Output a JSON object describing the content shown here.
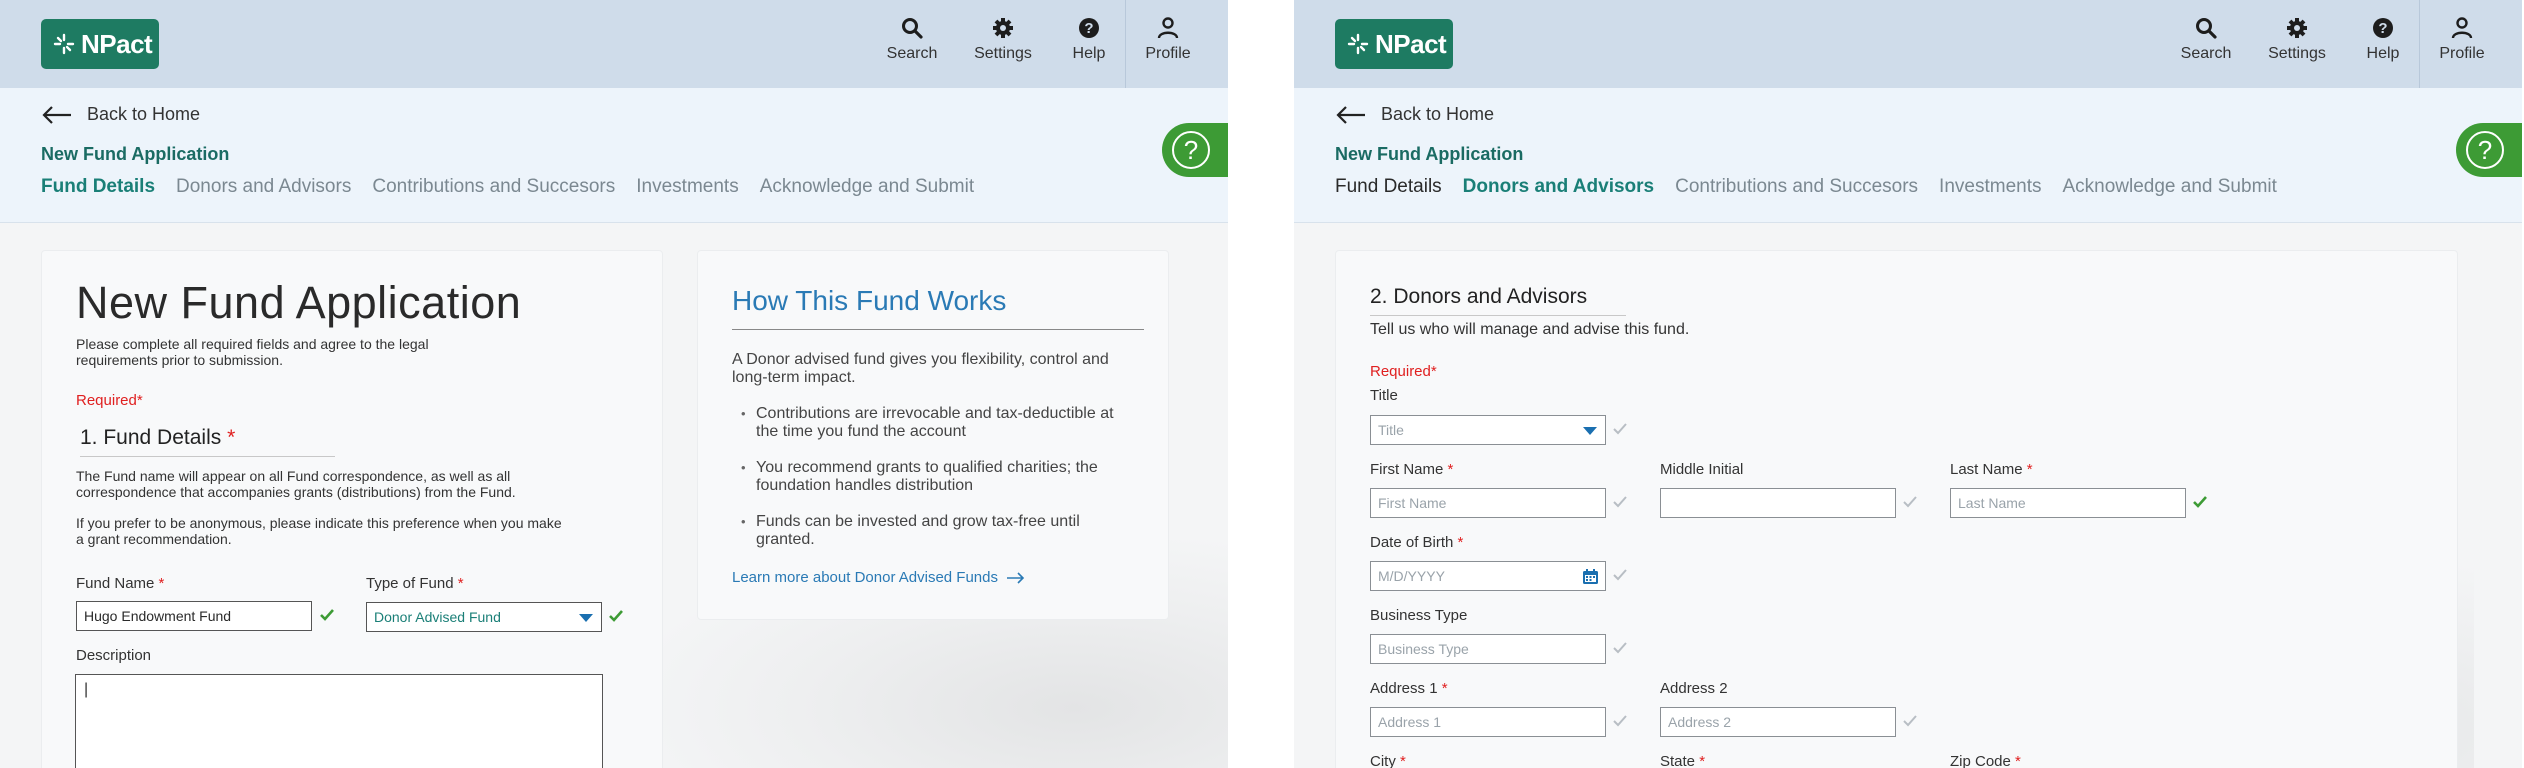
{
  "app": {
    "logo_text": "NPact"
  },
  "topnav": {
    "search": "Search",
    "settings": "Settings",
    "help": "Help",
    "profile": "Profile"
  },
  "subheader": {
    "back": "Back to Home",
    "title": "New Fund Application",
    "tabs": [
      "Fund Details",
      "Donors and Advisors",
      "Contributions and Succesors",
      "Investments",
      "Acknowledge and Submit"
    ],
    "help_icon": "?"
  },
  "left": {
    "heading": "New Fund Application",
    "intro": "Please complete all required fields and agree to the legal requirements prior to submission.",
    "required": "Required*",
    "section": "1. Fund Details",
    "section_star": "*",
    "para1": "The Fund name will appear on all Fund correspondence, as well as all correspondence that accompanies grants (distributions) from the Fund.",
    "para2": "If you prefer to be anonymous, please indicate this preference when you make a grant recommendation.",
    "fund_name_label": "Fund Name",
    "fund_name_value": "Hugo Endowment Fund",
    "type_label": "Type of Fund",
    "type_value": "Donor Advised Fund",
    "star": "*",
    "description_label": "Description",
    "description_value": "|"
  },
  "info": {
    "title": "How This Fund Works",
    "text": "A Donor advised fund gives you flexibility, control and long-term impact.",
    "bullets": [
      "Contributions are irrevocable and tax-deductible at the time you fund the account",
      "You recommend grants to qualified charities; the foundation handles distribution",
      "Funds can be invested and grow tax-free until granted."
    ],
    "link": "Learn more about Donor Advised Funds"
  },
  "right": {
    "section": "2. Donors and Advisors",
    "subtitle": "Tell us who will manage and advise this fund.",
    "required": "Required*",
    "title_label": "Title",
    "title_ph": "Title",
    "first_label": "First Name",
    "first_ph": "First Name",
    "middle_label": "Middle Initial",
    "last_label": "Last Name",
    "last_ph": "Last Name",
    "dob_label": "Date of Birth",
    "dob_ph": "M/D/YYYY",
    "business_label": "Business Type",
    "business_ph": "Business Type",
    "addr1_label": "Address 1",
    "addr1_ph": "Address 1",
    "addr2_label": "Address 2",
    "addr2_ph": "Address 2",
    "city_label": "City",
    "state_label": "State",
    "zip_label": "Zip Code",
    "star": "*"
  },
  "colors": {
    "brand": "#1e7b62",
    "accent": "#1a7f77",
    "help": "#3d9b35",
    "required": "#e02020",
    "link": "#2a7ab5",
    "check_valid": "#3d9b35",
    "check_idle": "#b8bec4"
  }
}
